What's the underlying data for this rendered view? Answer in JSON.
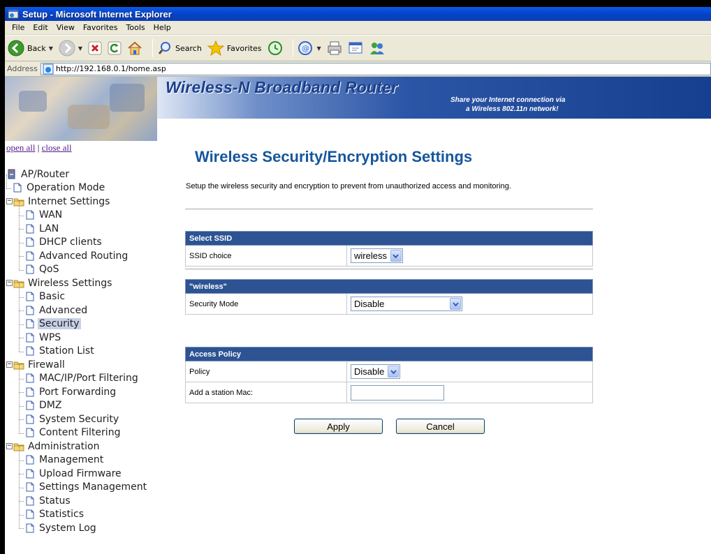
{
  "window": {
    "title": "Setup - Microsoft Internet Explorer"
  },
  "menu": [
    "File",
    "Edit",
    "View",
    "Favorites",
    "Tools",
    "Help"
  ],
  "toolbar": {
    "back_label": "Back",
    "search_label": "Search",
    "favorites_label": "Favorites"
  },
  "address": {
    "label": "Address",
    "url": "http://192.168.0.1/home.asp"
  },
  "banner": {
    "brand": "Wireless-N Broadband Router",
    "tagline1": "Share your Internet connection via",
    "tagline2": "a Wireless 802.11n network!"
  },
  "sidebar": {
    "open_all": "open all",
    "close_all": "close all",
    "separator": "|",
    "tree": [
      {
        "label": "AP/Router",
        "type": "root"
      },
      {
        "label": "Operation Mode",
        "type": "leaf"
      },
      {
        "label": "Internet Settings",
        "type": "folder"
      },
      {
        "label": "WAN",
        "type": "leaf"
      },
      {
        "label": "LAN",
        "type": "leaf"
      },
      {
        "label": "DHCP clients",
        "type": "leaf"
      },
      {
        "label": "Advanced Routing",
        "type": "leaf"
      },
      {
        "label": "QoS",
        "type": "leaf"
      },
      {
        "label": "Wireless Settings",
        "type": "folder"
      },
      {
        "label": "Basic",
        "type": "leaf"
      },
      {
        "label": "Advanced",
        "type": "leaf"
      },
      {
        "label": "Security",
        "type": "leaf",
        "selected": true
      },
      {
        "label": "WPS",
        "type": "leaf"
      },
      {
        "label": "Station List",
        "type": "leaf"
      },
      {
        "label": "Firewall",
        "type": "folder"
      },
      {
        "label": "MAC/IP/Port Filtering",
        "type": "leaf"
      },
      {
        "label": "Port Forwarding",
        "type": "leaf"
      },
      {
        "label": "DMZ",
        "type": "leaf"
      },
      {
        "label": "System Security",
        "type": "leaf"
      },
      {
        "label": "Content Filtering",
        "type": "leaf"
      },
      {
        "label": "Administration",
        "type": "folder"
      },
      {
        "label": "Management",
        "type": "leaf"
      },
      {
        "label": "Upload Firmware",
        "type": "leaf"
      },
      {
        "label": "Settings Management",
        "type": "leaf"
      },
      {
        "label": "Status",
        "type": "leaf"
      },
      {
        "label": "Statistics",
        "type": "leaf"
      },
      {
        "label": "System Log",
        "type": "leaf"
      }
    ]
  },
  "main": {
    "title": "Wireless Security/Encryption Settings",
    "description": "Setup the wireless security and encryption to prevent from unauthorized access and monitoring.",
    "ssid_section": {
      "header": "Select SSID",
      "label": "SSID choice",
      "value": "wireless"
    },
    "security_section": {
      "header": "\"wireless\"",
      "label": "Security Mode",
      "value": "Disable"
    },
    "access_section": {
      "header": "Access Policy",
      "policy_label": "Policy",
      "policy_value": "Disable",
      "mac_label": "Add a station Mac:",
      "mac_value": ""
    },
    "apply_label": "Apply",
    "cancel_label": "Cancel"
  }
}
